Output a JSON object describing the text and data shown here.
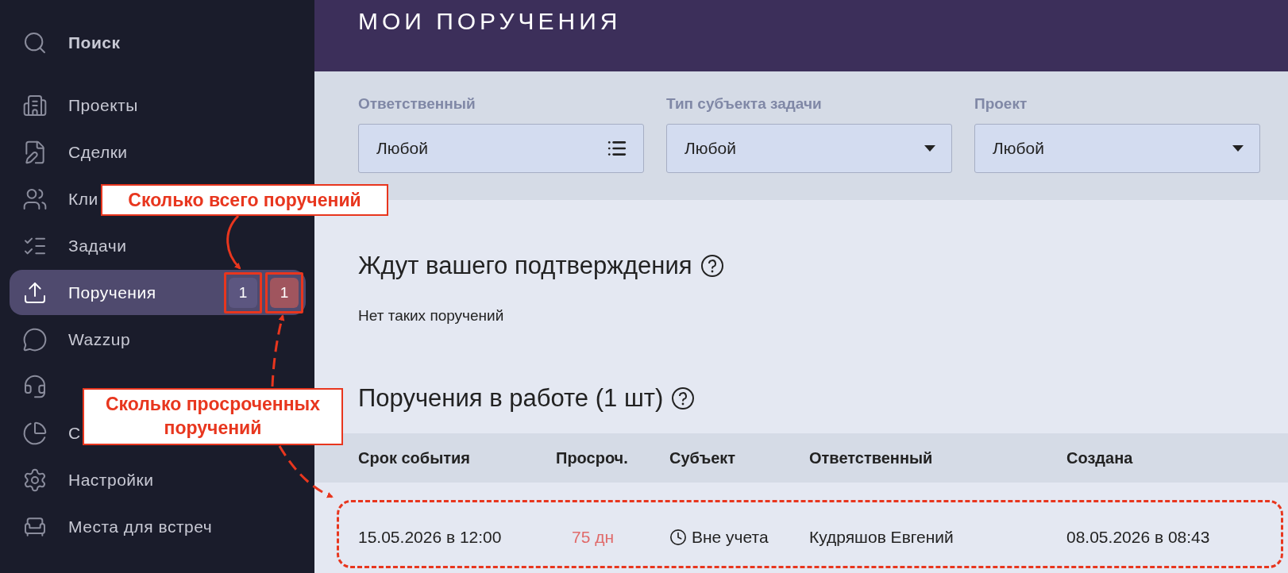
{
  "sidebar": {
    "items": [
      {
        "label": "Поиск",
        "kind": "search",
        "selected": false
      },
      {
        "label": "Проекты",
        "kind": "link",
        "selected": false
      },
      {
        "label": "Сделки",
        "kind": "link",
        "selected": false
      },
      {
        "label": "Кли",
        "kind": "link",
        "selected": false
      },
      {
        "label": "Задачи",
        "kind": "link",
        "selected": false
      },
      {
        "label": "Поручения",
        "kind": "link",
        "selected": true,
        "badges": [
          {
            "kind": "total",
            "text": "1"
          },
          {
            "kind": "overdue",
            "text": "1"
          }
        ]
      },
      {
        "label": "Wazzup",
        "kind": "link",
        "selected": false
      },
      {
        "kind": "link",
        "selected": false
      },
      {
        "label": "С",
        "kind": "link",
        "selected": false
      },
      {
        "label": "Настройки",
        "kind": "link",
        "selected": false
      },
      {
        "label": "Места для встреч",
        "kind": "link",
        "selected": false
      }
    ]
  },
  "header": {
    "title": "МОИ ПОРУЧЕНИЯ"
  },
  "filters": [
    {
      "label": "Ответственный",
      "value": "Любой",
      "kind": "list"
    },
    {
      "label": "Тип субъекта задачи",
      "value": "Любой",
      "kind": "dropdown"
    },
    {
      "label": "Проект",
      "value": "Любой",
      "kind": "dropdown"
    }
  ],
  "pending": {
    "title": "Ждут вашего подтверждения",
    "empty_text": "Нет таких поручений"
  },
  "in_progress": {
    "title": "Поручения в работе (1 шт)",
    "table": {
      "columns": [
        "Срок события",
        "Просроч.",
        "Субъект",
        "Ответственный",
        "Создана"
      ],
      "rows": [
        {
          "cells": [
            "15.05.2026 в 12:00",
            "75 дн",
            "Вне учета",
            "Кудряшов Евгений",
            "08.05.2026 в 08:43"
          ],
          "overdue": true
        }
      ]
    }
  },
  "annotations": [
    {
      "kind": "total",
      "text": "Сколько всего поручений"
    },
    {
      "kind": "overdue",
      "text": "Сколько просроченных поручений"
    }
  ]
}
